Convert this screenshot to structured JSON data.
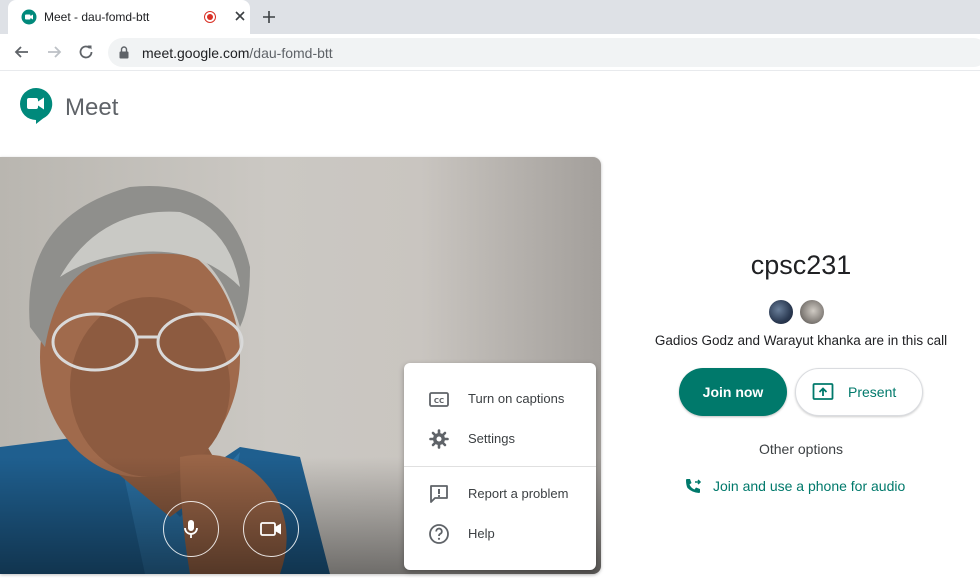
{
  "browser": {
    "tab_title": "Meet - dau-fomd-btt",
    "url_host": "meet.google.com",
    "url_path": "/dau-fomd-btt"
  },
  "app": {
    "name": "Meet"
  },
  "menu": {
    "items": [
      {
        "label": "Turn on captions",
        "icon": "captions-icon"
      },
      {
        "label": "Settings",
        "icon": "gear-icon"
      },
      {
        "label": "Report a problem",
        "icon": "feedback-icon"
      },
      {
        "label": "Help",
        "icon": "help-icon"
      }
    ]
  },
  "panel": {
    "meeting_name": "cpsc231",
    "in_call_text": "Gadios Godz and Warayut khanka are in this call",
    "join_label": "Join now",
    "present_label": "Present",
    "other_options": "Other options",
    "phone_label": "Join and use a phone for audio"
  },
  "colors": {
    "accent": "#00796b",
    "record": "#d93025",
    "meet_green": "#00897b",
    "meet_yellow": "#fbbc04"
  }
}
